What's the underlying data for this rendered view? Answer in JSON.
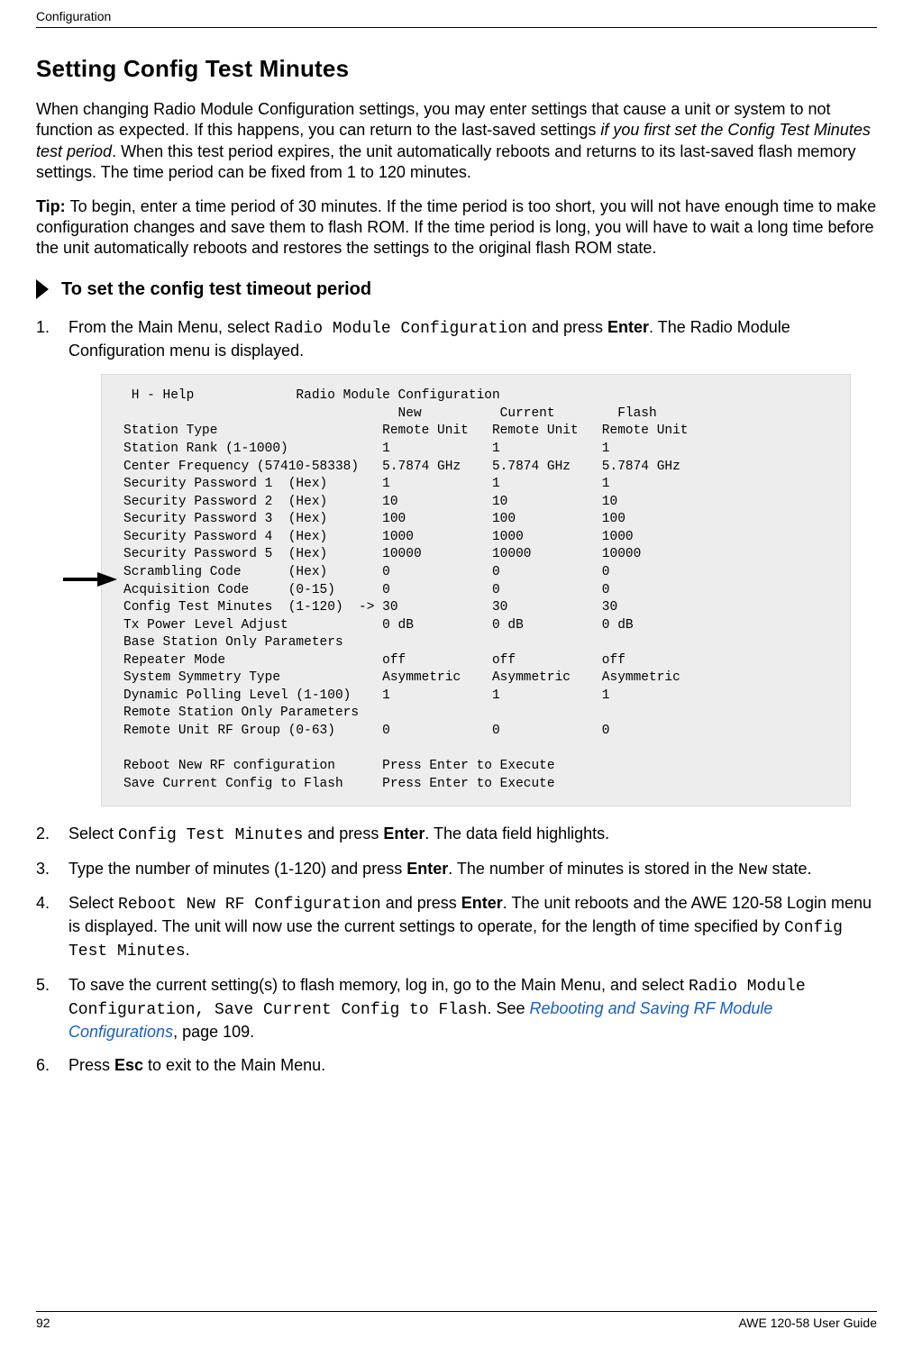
{
  "header": {
    "section": "Configuration"
  },
  "title": "Setting Config Test Minutes",
  "intro": {
    "p1a": "When changing Radio Module Configuration settings, you may enter settings that cause a unit or system to not function as expected. If this happens, you can return to the last-saved settings ",
    "p1b_italic": "if you first set the Config Test Minutes test period",
    "p1c": ". When this test period expires, the unit automatically reboots and returns to its last-saved flash memory settings. The time period can be fixed from 1 to 120 minutes.",
    "tip_label": "Tip: ",
    "tip_body": "To begin, enter a time period of 30 minutes. If the time period is too short, you will not have enough time to make configuration changes and save them to flash ROM. If the time period is long, you will have to wait a long time before the unit automatically reboots and restores the settings to the original flash ROM state."
  },
  "subhead": "To set the config test timeout period",
  "steps": {
    "s1a": "From the Main Menu, select ",
    "s1b_mono": "Radio Module Configuration",
    "s1c": " and press ",
    "s1d_bold": "Enter",
    "s1e": ". The Radio Module Configuration menu is displayed.",
    "s2a": "Select ",
    "s2b_mono": "Config Test Minutes",
    "s2c": " and press ",
    "s2d_bold": "Enter",
    "s2e": ". The data field highlights.",
    "s3a": "Type the number of minutes (1-120) and press ",
    "s3b_bold": "Enter",
    "s3c": ". The number of minutes is stored in the ",
    "s3d_mono": "New",
    "s3e": " state.",
    "s4a": "Select ",
    "s4b_mono": "Reboot New RF Configuration",
    "s4c": " and press ",
    "s4d_bold": "Enter",
    "s4e": ". The unit reboots and the AWE 120-58 Login menu is displayed. The unit will now use the current settings to operate, for the length of time specified by ",
    "s4f_mono": "Config Test Minutes",
    "s4g": ".",
    "s5a": "To save the current setting(s) to flash memory, log in, go to the Main Menu, and select ",
    "s5b_mono": "Radio Module Configuration, Save Current Config to Flash",
    "s5c": ". See ",
    "s5d_link": "Rebooting and Saving RF Module Configurations",
    "s5e": ", page 109.",
    "s6a": "Press ",
    "s6b_bold": "Esc",
    "s6c": " to exit to the Main Menu."
  },
  "terminal": " H - Help             Radio Module Configuration\n                                   New          Current        Flash\nStation Type                     Remote Unit   Remote Unit   Remote Unit\nStation Rank (1-1000)            1             1             1\nCenter Frequency (57410-58338)   5.7874 GHz    5.7874 GHz    5.7874 GHz\nSecurity Password 1  (Hex)       1             1             1\nSecurity Password 2  (Hex)       10            10            10\nSecurity Password 3  (Hex)       100           100           100\nSecurity Password 4  (Hex)       1000          1000          1000\nSecurity Password 5  (Hex)       10000         10000         10000\nScrambling Code      (Hex)       0             0             0\nAcquisition Code     (0-15)      0             0             0\nConfig Test Minutes  (1-120)  -> 30            30            30\nTx Power Level Adjust            0 dB          0 dB          0 dB\nBase Station Only Parameters\nRepeater Mode                    off           off           off\nSystem Symmetry Type             Asymmetric    Asymmetric    Asymmetric\nDynamic Polling Level (1-100)    1             1             1\nRemote Station Only Parameters\nRemote Unit RF Group (0-63)      0             0             0\n\nReboot New RF configuration      Press Enter to Execute\nSave Current Config to Flash     Press Enter to Execute",
  "footer": {
    "page": "92",
    "doc": "AWE 120-58 User Guide"
  }
}
